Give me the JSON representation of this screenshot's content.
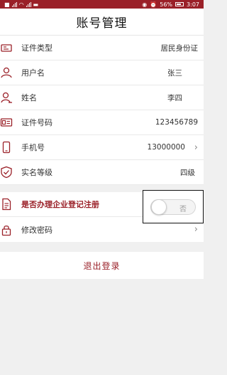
{
  "status": {
    "battery": "56%",
    "time": "3:07"
  },
  "header": {
    "title": "账号管理"
  },
  "rows": [
    {
      "label": "证件类型",
      "value": "居民身份证",
      "icon": "id-card-icon"
    },
    {
      "label": "用户名",
      "value": "张三",
      "icon": "user-icon"
    },
    {
      "label": "姓名",
      "value": "李四",
      "icon": "person-edit-icon"
    },
    {
      "label": "证件号码",
      "value": "123456789",
      "icon": "id-number-icon"
    },
    {
      "label": "手机号",
      "value": "13000000",
      "icon": "phone-icon"
    },
    {
      "label": "实名等级",
      "value": "四级",
      "icon": "shield-check-icon"
    }
  ],
  "registration": {
    "label": "是否办理企业登记注册",
    "toggle_text": "否",
    "icon": "document-icon"
  },
  "password": {
    "label": "修改密码",
    "icon": "lock-icon"
  },
  "logout": {
    "label": "退出登录"
  },
  "colors": {
    "accent": "#9a2028",
    "background": "#f0f0f0"
  }
}
